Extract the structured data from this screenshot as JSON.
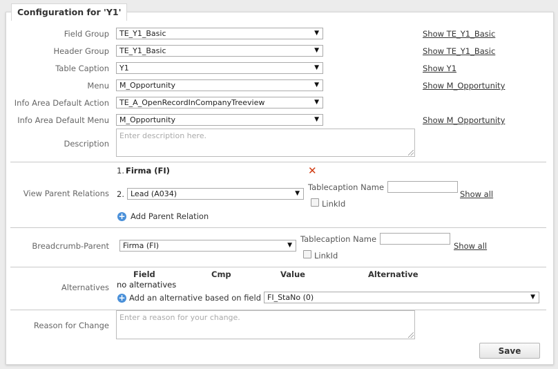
{
  "title": "Configuration for 'Y1'",
  "fields": {
    "field_group": {
      "label": "Field Group",
      "value": "TE_Y1_Basic",
      "link": "Show TE_Y1_Basic"
    },
    "header_group": {
      "label": "Header Group",
      "value": "TE_Y1_Basic",
      "link": "Show TE_Y1_Basic"
    },
    "table_caption": {
      "label": "Table Caption",
      "value": "Y1",
      "link": "Show Y1"
    },
    "menu": {
      "label": "Menu",
      "value": "M_Opportunity",
      "link": "Show M_Opportunity"
    },
    "info_area_default_action": {
      "label": "Info Area Default Action",
      "value": "TE_A_OpenRecordInCompanyTreeview"
    },
    "info_area_default_menu": {
      "label": "Info Area Default Menu",
      "value": "M_Opportunity",
      "link": "Show M_Opportunity"
    },
    "description": {
      "label": "Description",
      "placeholder": "Enter description here."
    }
  },
  "parent_relations": {
    "label": "View Parent Relations",
    "item1_num": "1.",
    "item1_value": "Firma (FI)",
    "item2_num": "2.",
    "item2_value": "Lead (A034)",
    "tablecaption_label": "Tablecaption Name",
    "linkid_label": "LinkId",
    "show_all": "Show all",
    "add_label": "Add Parent Relation"
  },
  "breadcrumb": {
    "label": "Breadcrumb-Parent",
    "value": "Firma (FI)",
    "tablecaption_label": "Tablecaption Name",
    "linkid_label": "LinkId",
    "show_all": "Show all"
  },
  "alternatives": {
    "label": "Alternatives",
    "headers": [
      "Field",
      "Cmp",
      "Value",
      "Alternative"
    ],
    "empty_text": "no alternatives",
    "add_label": "Add an alternative based on field",
    "add_field_value": "FI_StaNo (0)"
  },
  "reason": {
    "label": "Reason for Change",
    "placeholder": "Enter a reason for your change."
  },
  "save_label": "Save",
  "icons": {
    "dropdown": "▼",
    "delete": "✕",
    "add": "+"
  }
}
